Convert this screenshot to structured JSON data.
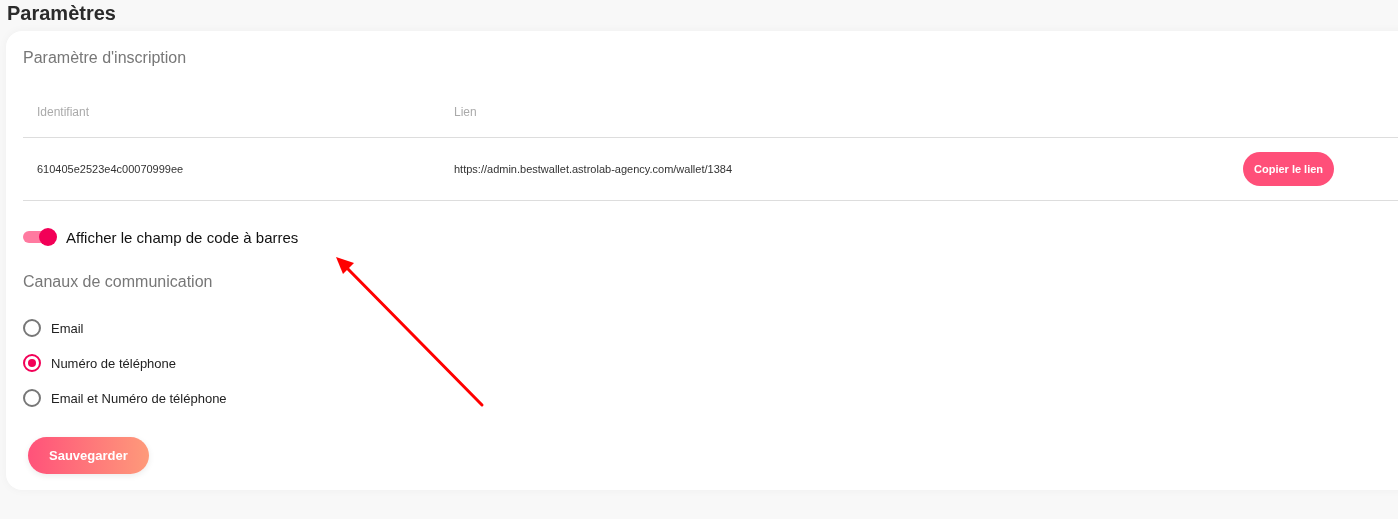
{
  "page_title": "Paramètres",
  "registration": {
    "title": "Paramètre d'inscription",
    "columns": [
      "Identifiant",
      "Lien"
    ],
    "rows": [
      {
        "identifier": "610405e2523e4c00070999ee",
        "link": "https://admin.bestwallet.astrolab-agency.com/wallet/1384",
        "action": "Copier le lien"
      }
    ]
  },
  "barcode_toggle": {
    "label": "Afficher le champ de code à barres",
    "on": true
  },
  "channels": {
    "title": "Canaux de communication",
    "options": [
      {
        "label": "Email",
        "selected": false
      },
      {
        "label": "Numéro de téléphone",
        "selected": true
      },
      {
        "label": "Email et Numéro de téléphone",
        "selected": false
      }
    ]
  },
  "save_button": "Sauvegarder"
}
